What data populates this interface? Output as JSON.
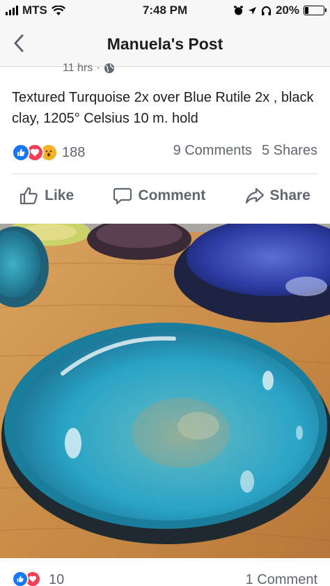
{
  "status_bar": {
    "carrier": "MTS",
    "time": "7:48 PM",
    "battery": "20%",
    "battery_level": 0.2
  },
  "nav": {
    "title": "Manuela's Post",
    "back_icon": "chevron-left-icon"
  },
  "post": {
    "time_ago": "11 hrs",
    "separator": "·",
    "privacy_icon": "globe-icon",
    "text": "Textured Turquoise 2x over Blue Rutile 2x , black clay, 1205° Celsius 10 m. hold",
    "reaction_count": "188",
    "comments": "9 Comments",
    "shares": "5 Shares"
  },
  "actions": {
    "like": "Like",
    "comment": "Comment",
    "share": "Share"
  },
  "photo": {
    "subject": "turquoise glazed oval ceramic bowl on wooden table"
  },
  "next_post": {
    "reaction_count": "10",
    "comments": "1 Comment"
  },
  "colors": {
    "facebook_blue": "#1877f2",
    "love_red": "#f33e58",
    "wow_yellow": "#f7b125",
    "secondary_text": "#606770"
  }
}
